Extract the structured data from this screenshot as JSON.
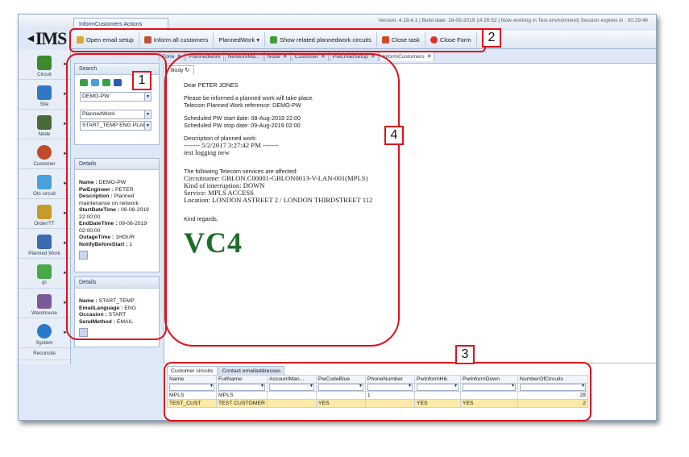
{
  "app": {
    "logo": "IMS",
    "window_tab": "InformCustomers Actions",
    "status_bar": "Version: 4.19.4.1 | Build date: 16-05-2019 14:26:52 | Now working in Test environment| Session expires in : 00:29:46"
  },
  "toolbar": {
    "open_email_setup": "Open email setup",
    "inform_all_customers": "Inform all customers",
    "planned_work": "PlannedWork ▾",
    "show_related": "Show related plannedwork circuits",
    "close_task": "Close task",
    "close_form": "Close Form"
  },
  "doc_tabs": [
    "Zone",
    "Plannedwork",
    "NetworkMa...",
    "Node",
    "Customer",
    "PwEmailSetup",
    "InformCustomers"
  ],
  "nav": [
    {
      "label": "Circuit",
      "color": "#3b8a2e"
    },
    {
      "label": "Site",
      "color": "#2f78c8"
    },
    {
      "label": "Node",
      "color": "#4a6a3a"
    },
    {
      "label": "Customer",
      "color": "#c04a2a"
    },
    {
      "label": "Olo circuit",
      "color": "#4aa0d8"
    },
    {
      "label": "Order/TT",
      "color": "#c89a2a"
    },
    {
      "label": "Planned Work",
      "color": "#3a6ab0"
    },
    {
      "label": "IP",
      "color": "#49a84a"
    },
    {
      "label": "Warehouse",
      "color": "#7a5a9a"
    },
    {
      "label": "System",
      "color": "#2a7ac8"
    }
  ],
  "nav_footer": "Reconcile",
  "search": {
    "header": "Search",
    "combo1": "DEMO-PW",
    "combo2": "PlannedWork",
    "combo3": "START_TEMP ENG PLAI"
  },
  "details1": {
    "header": "Details",
    "name_label": "Name :",
    "name": "DEMO-PW",
    "pwengineer_label": "PwEngineer :",
    "pwengineer": "PETER",
    "description_label": "Description :",
    "description": "Planned maintenance on network",
    "start_label": "StartDateTime :",
    "start": "08-08-2019 22:00:00",
    "end_label": "EndDateTime :",
    "end": "09-08-2019 02:00:00",
    "outage_label": "OutageTime :",
    "outage": "1HOUR",
    "notify_label": "NotifyBeforeStart :",
    "notify": "1"
  },
  "details2": {
    "header": "Details",
    "name_label": "Name :",
    "name": "START_TEMP",
    "lang_label": "EmailLanguage :",
    "lang": "ENG",
    "occasion_label": "Occasion :",
    "occasion": "START",
    "send_label": "SendMethod :",
    "send": "EMAIL"
  },
  "body_tab": "Body",
  "email": {
    "greeting": "Dear PETER JONES",
    "line1": "Please be informed a planned work will take place.",
    "line2": "Telecom Planned Work reference: DEMO-PW",
    "start": "Scheduled PW start date: 08-Aug-2019 22:00",
    "stop": "Scheduled PW stop date: 09-Aug-2019 02:00",
    "desc_label": "Description of planned work:",
    "desc_line": "------- 5/2/2017 3:27:42 PM -------",
    "desc_text": "test logging new",
    "affected": "The following Telecom services are affected:",
    "circuit": "Circuitname: GBLON.C00001-GBLON0013-V-LAN-001(MPLS)",
    "interruption": "Kind of interruption: DOWN",
    "service": "Service: MPLS ACCESS",
    "location": "Location: LONDON ASTREET 2 / LONDON THIRDSTREET 112",
    "regards": "Kind regards,",
    "logo": "VC4"
  },
  "bottom": {
    "tab1": "Customer circuits",
    "tab2": "Contact emailaddresses",
    "columns": [
      "Name",
      "FullName",
      "AccountMan...",
      "PwCodeBlue",
      "PhoneNumber",
      "PwInformHik",
      "PwInformDown",
      "NumberOfCircuits"
    ],
    "rows": [
      [
        "MPLS",
        "MPLS",
        "",
        "",
        "1",
        "",
        "",
        "28"
      ],
      [
        "TEST_CUST",
        "TEST CUSTOMER",
        "",
        "YES",
        "",
        "YES",
        "YES",
        "2"
      ]
    ]
  },
  "annotations": [
    "1",
    "2",
    "3",
    "4"
  ]
}
